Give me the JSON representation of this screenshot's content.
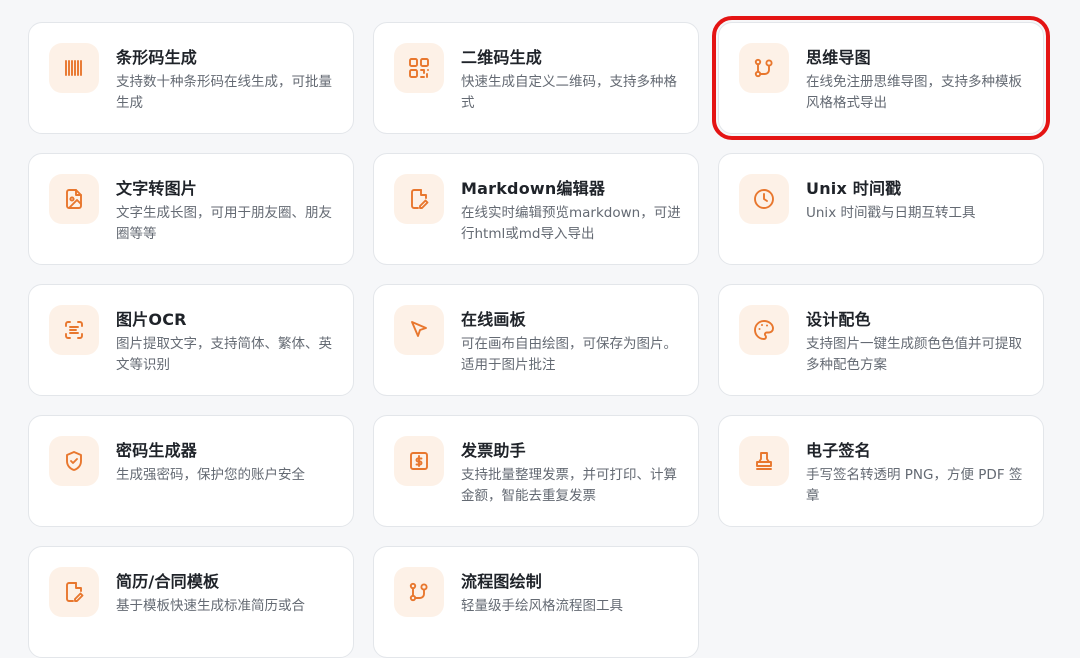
{
  "accent_color": "#e8772e",
  "icon_bg_color": "#fdf1e7",
  "highlight_color": "#e41414",
  "tools": [
    {
      "title": "条形码生成",
      "desc": "支持数十种条形码在线生成，可批量生成",
      "icon": "barcode-icon",
      "highlighted": false
    },
    {
      "title": "二维码生成",
      "desc": "快速生成自定义二维码，支持多种格式",
      "icon": "qrcode-icon",
      "highlighted": false
    },
    {
      "title": "思维导图",
      "desc": "在线免注册思维导图，支持多种模板风格格式导出",
      "icon": "mindmap-icon",
      "highlighted": true
    },
    {
      "title": "文字转图片",
      "desc": "文字生成长图，可用于朋友圈、朋友圈等等",
      "icon": "image-file-icon",
      "highlighted": false
    },
    {
      "title": "Markdown编辑器",
      "desc": "在线实时编辑预览markdown，可进行html或md导入导出",
      "icon": "edit-file-icon",
      "highlighted": false
    },
    {
      "title": "Unix 时间戳",
      "desc": "Unix 时间戳与日期互转工具",
      "icon": "clock-icon",
      "highlighted": false
    },
    {
      "title": "图片OCR",
      "desc": "图片提取文字，支持简体、繁体、英文等识别",
      "icon": "scan-text-icon",
      "highlighted": false
    },
    {
      "title": "在线画板",
      "desc": "可在画布自由绘图，可保存为图片。适用于图片批注",
      "icon": "pointer-icon",
      "highlighted": false
    },
    {
      "title": "设计配色",
      "desc": "支持图片一键生成颜色色值并可提取多种配色方案",
      "icon": "palette-icon",
      "highlighted": false
    },
    {
      "title": "密码生成器",
      "desc": "生成强密码，保护您的账户安全",
      "icon": "shield-icon",
      "highlighted": false
    },
    {
      "title": "发票助手",
      "desc": "支持批量整理发票，并可打印、计算金额，智能去重复发票",
      "icon": "invoice-icon",
      "highlighted": false
    },
    {
      "title": "电子签名",
      "desc": "手写签名转透明 PNG，方便 PDF 签章",
      "icon": "stamp-icon",
      "highlighted": false
    },
    {
      "title": "简历/合同模板",
      "desc": "基于模板快速生成标准简历或合",
      "icon": "edit-file-icon",
      "highlighted": false
    },
    {
      "title": "流程图绘制",
      "desc": "轻量级手绘风格流程图工具",
      "icon": "flowchart-icon",
      "highlighted": false
    }
  ]
}
